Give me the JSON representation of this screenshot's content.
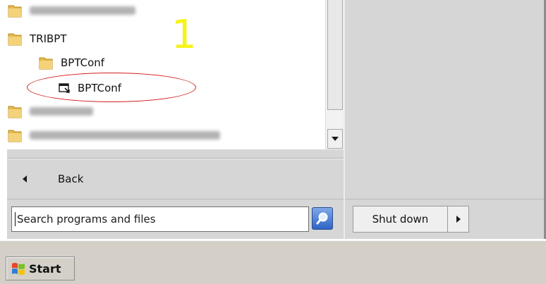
{
  "programs": {
    "items": [
      {
        "type": "folder-blurred",
        "level": 0
      },
      {
        "type": "folder",
        "label": "TRIBPT",
        "level": 0
      },
      {
        "type": "folder",
        "label": "BPTConf",
        "level": 1
      },
      {
        "type": "shortcut",
        "label": "BPTConf",
        "level": 2
      },
      {
        "type": "folder-blurred",
        "level": 0
      },
      {
        "type": "folder-blurred",
        "level": 0
      }
    ]
  },
  "back": {
    "label": "Back"
  },
  "search": {
    "placeholder": "Search programs and files"
  },
  "shutdown": {
    "label": "Shut down"
  },
  "taskbar": {
    "start_label": "Start"
  },
  "annotation": {
    "number": "1",
    "color": "#f7f31a",
    "ellipse_color": "#d21c1c"
  },
  "colors": {
    "panel_gray": "#d6d6d6",
    "taskbar": "#d4d0c8",
    "search_button": "#2d64c6"
  }
}
